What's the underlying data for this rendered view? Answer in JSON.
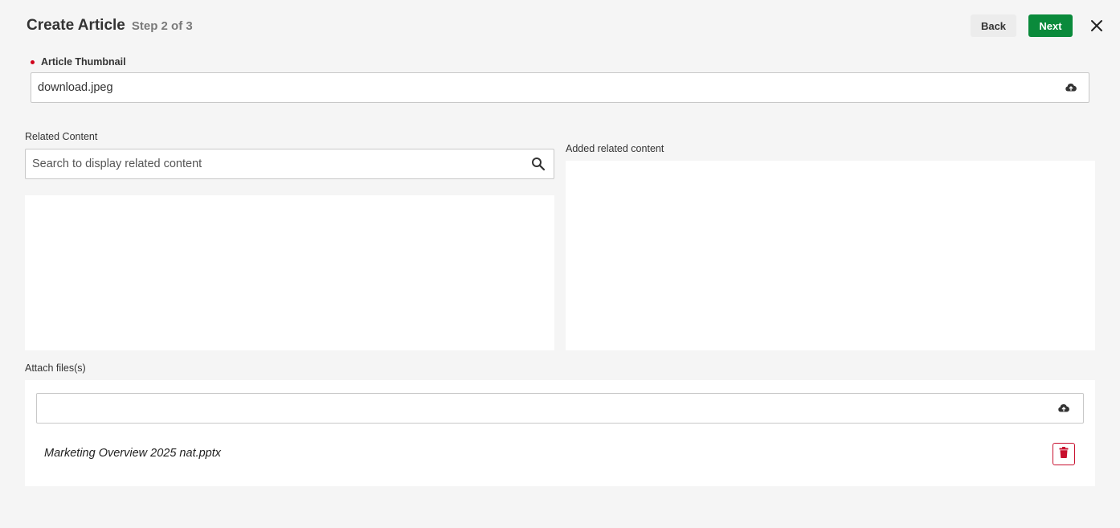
{
  "header": {
    "title": "Create Article",
    "step": "Step 2 of 3",
    "back_label": "Back",
    "next_label": "Next"
  },
  "thumbnail": {
    "label": "Article Thumbnail",
    "value": "download.jpeg"
  },
  "related": {
    "label": "Related Content",
    "search_placeholder": "Search to display related content",
    "added_label": "Added related content"
  },
  "attach": {
    "label": "Attach files(s)",
    "files": [
      {
        "name": "Marketing Overview 2025 nat.pptx"
      }
    ]
  },
  "colors": {
    "primary": "#0a8a3b",
    "danger": "#c8102e",
    "required": "#d0021b"
  }
}
